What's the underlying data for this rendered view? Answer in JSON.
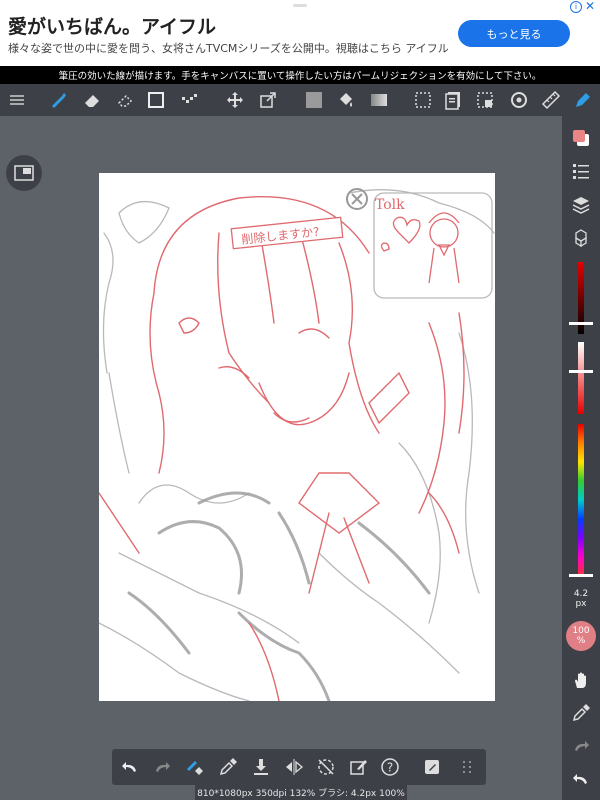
{
  "ad": {
    "title": "愛がいちばん。アイフル",
    "subtitle": "様々な姿で世の中に愛を問う、女将さんTVCMシリーズを公開中。視聴はこちら アイフル",
    "button": "もっと見る",
    "info_icon": "i",
    "close_icon": "✕"
  },
  "notice": "筆圧の効いた線が描けます。手をキャンバスに置いて操作したい方はパームリジェクションを有効にして下さい。",
  "toolbar": {
    "icons": [
      "menu-icon",
      "brush-icon",
      "eraser-icon",
      "lasso-eraser-icon",
      "rectangle-icon",
      "dotted-icon",
      "move-icon",
      "transform-icon",
      "color-swatch-icon",
      "bucket-icon",
      "gradient-icon",
      "select-icon",
      "pages-icon",
      "selection-icon",
      "rotate-icon",
      "ruler-icon",
      "pen-icon"
    ]
  },
  "brush": {
    "size_value": "4.2",
    "size_unit": "px"
  },
  "opacity": {
    "value": "100",
    "unit": "%"
  },
  "sketch": {
    "label_top": "削除しますか?",
    "label_talk": "Tolk"
  },
  "colors": {
    "accent": "#2e9fe6",
    "panel": "#3d4047",
    "background": "#5d6168",
    "sketch_red": "#e06a6f",
    "opacity_badge": "#e07f86"
  },
  "status": "810*1080px 350dpi 132% ブラシ: 4.2px 100%"
}
